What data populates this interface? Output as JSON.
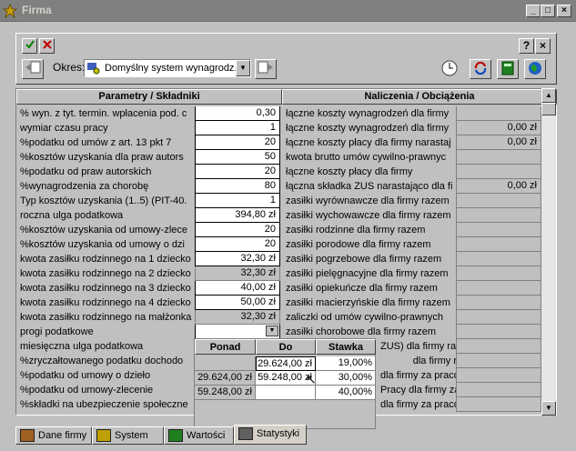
{
  "window": {
    "title": "Firma",
    "minimize": "_",
    "maximize": "□",
    "close": "×"
  },
  "toolbar": {
    "okres_label": "Okres:",
    "okres_value": "Domyślny system wynagrodz...",
    "help_label": "?",
    "close_label": "×"
  },
  "headers": {
    "left": "Parametry / Składniki",
    "right": "Naliczenia / Obciążenia"
  },
  "left_rows": [
    {
      "label": "% wyn. z tyt. termin. wpłacenia pod. c",
      "value": "0,30"
    },
    {
      "label": "wymiar czasu pracy",
      "value": "1"
    },
    {
      "label": "%podatku od umów z art. 13 pkt 7",
      "value": "20"
    },
    {
      "label": "%kosztów uzyskania dla praw autors",
      "value": "50"
    },
    {
      "label": "%podatku od praw autorskich",
      "value": "20"
    },
    {
      "label": "%wynagrodzenia za chorobę",
      "value": "80"
    },
    {
      "label": "Typ kosztów uzyskania (1..5) (PIT-40.",
      "value": "1"
    },
    {
      "label": "roczna ulga podatkowa",
      "value": "394,80 zł"
    },
    {
      "label": "%kosztów uzyskania od umowy-zlece",
      "value": "20"
    },
    {
      "label": "%kosztów uzyskania od umowy o dzi",
      "value": "20"
    },
    {
      "label": "kwota zasiłku rodzinnego na 1 dziecko",
      "value": "32,30 zł"
    },
    {
      "label": "kwota zasiłku rodzinnego na 2 dziecko",
      "value": "32,30 zł",
      "gray": true
    },
    {
      "label": "kwota zasiłku rodzinnego na 3 dziecko",
      "value": "40,00 zł"
    },
    {
      "label": "kwota zasiłku rodzinnego na 4 dziecko",
      "value": "50,00 zł"
    },
    {
      "label": "kwota zasiłku rodzinnego na małżonka",
      "value": "32,30 zł",
      "gray": true
    },
    {
      "label": "progi podatkowe",
      "value": ""
    },
    {
      "label": "miesięczna ulga podatkowa",
      "value": ""
    },
    {
      "label": "%zryczałtowanego podatku dochodo",
      "value": ""
    },
    {
      "label": "%podatku od umowy o dzieło",
      "value": ""
    },
    {
      "label": "%podatku od umowy-zlecenie",
      "value": ""
    },
    {
      "label": "%składki na ubezpieczenie społeczne",
      "value": ""
    }
  ],
  "right_rows": [
    {
      "label": "łączne koszty wynagrodzeń dla firmy",
      "value": ""
    },
    {
      "label": "łączne koszty wynagrodzeń dla firmy",
      "value": "0,00 zł"
    },
    {
      "label": "łączne koszty płacy dla firmy narastaj",
      "value": "0,00 zł"
    },
    {
      "label": "kwota brutto umów cywilno-prawnyc",
      "value": ""
    },
    {
      "label": "łączne koszty płacy dla firmy",
      "value": ""
    },
    {
      "label": "łączna składka ZUS narastająco dla fi",
      "value": "0,00 zł"
    },
    {
      "label": "zasiłki wyrównawcze dla firmy razem",
      "value": ""
    },
    {
      "label": "zasiłki wychowawcze dla firmy razem",
      "value": ""
    },
    {
      "label": "zasiłki rodzinne dla firmy razem",
      "value": ""
    },
    {
      "label": "zasiłki porodowe dla firmy razem",
      "value": ""
    },
    {
      "label": "zasiłki pogrzebowe dla firmy razem",
      "value": ""
    },
    {
      "label": "zasiłki pielęgnacyjne dla firmy razem",
      "value": ""
    },
    {
      "label": "zasiłki opiekuńcze dla firmy razem",
      "value": ""
    },
    {
      "label": "zasiłki macierzyńskie dla firmy razem",
      "value": ""
    },
    {
      "label": "zaliczki od umów cywilno-prawnych",
      "value": ""
    },
    {
      "label": "zasiłki chorobowe dla firmy razem",
      "value": ""
    },
    {
      "label": "ZUS) dla firmy raz",
      "value": ""
    },
    {
      "label": "dla firmy r",
      "value": ""
    },
    {
      "label": "dla firmy za praco",
      "value": ""
    },
    {
      "label": "Pracy dla firmy za",
      "value": ""
    },
    {
      "label": "dla firmy za pracow",
      "value": ""
    }
  ],
  "popup": {
    "headers": [
      "Ponad",
      "Do",
      "Stawka"
    ],
    "rows": [
      [
        "",
        "29.624,00 zł",
        "19,00%"
      ],
      [
        "29.624,00 zł",
        "59.248,00 zł",
        "30,00%"
      ],
      [
        "59.248,00 zł",
        "",
        "40,00%"
      ]
    ]
  },
  "tabs": [
    {
      "label": "Dane firmy",
      "icon": "house-icon"
    },
    {
      "label": "System",
      "icon": "cars-icon"
    },
    {
      "label": "Wartości",
      "icon": "calculator-icon"
    },
    {
      "label": "Statystyki",
      "icon": "notebook-icon"
    }
  ]
}
